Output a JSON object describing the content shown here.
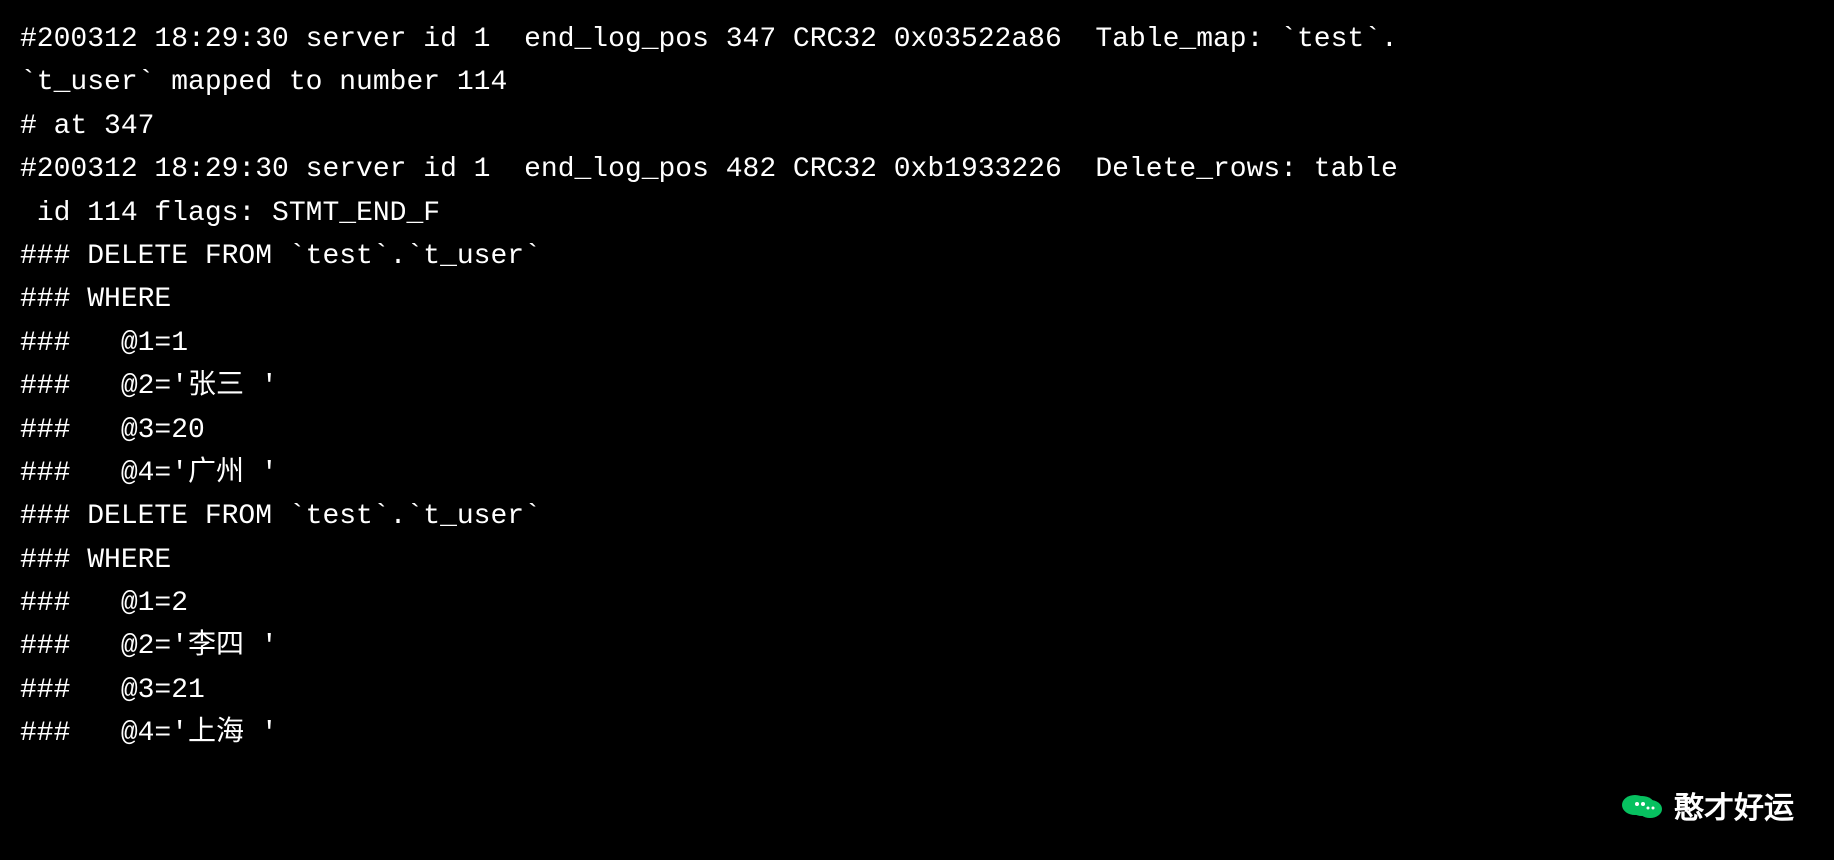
{
  "terminal": {
    "background": "#000000",
    "foreground": "#ffffff",
    "lines": [
      "#200312 18:29:30 server id 1  end_log_pos 347 CRC32 0x03522a86  Table_map: `test`.",
      "`t_user` mapped to number 114",
      "# at 347",
      "#200312 18:29:30 server id 1  end_log_pos 482 CRC32 0xb1933226  Delete_rows: table",
      " id 114 flags: STMT_END_F",
      "### DELETE FROM `test`.`t_user`",
      "### WHERE",
      "###   @1=1",
      "###   @2='张三 '",
      "###   @3=20",
      "###   @4='广州 '",
      "### DELETE FROM `test`.`t_user`",
      "### WHERE",
      "###   @1=2",
      "###   @2='李四 '",
      "###   @3=21",
      "###   @4='上海 '"
    ]
  },
  "watermark": {
    "text": "憨才好运",
    "icon": "wechat"
  }
}
